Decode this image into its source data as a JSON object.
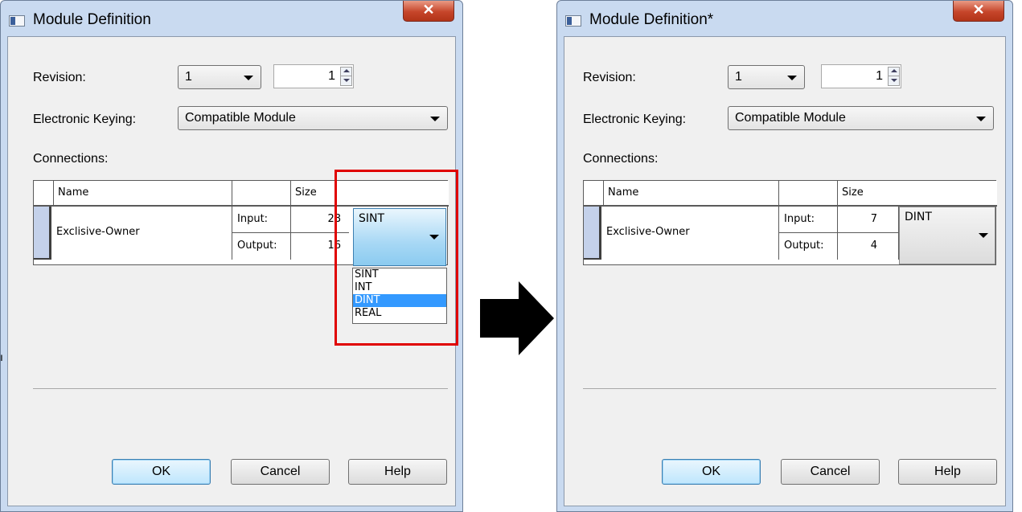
{
  "left": {
    "title": "Module Definition",
    "revision_label": "Revision:",
    "revision_major": "1",
    "revision_minor": "1",
    "keying_label": "Electronic Keying:",
    "keying_value": "Compatible Module",
    "connections_label": "Connections:",
    "grid": {
      "col_name": "Name",
      "col_size": "Size",
      "row_name": "Exclisive-Owner",
      "input_label": "Input:",
      "input_size": "28",
      "output_label": "Output:",
      "output_size": "16",
      "type_value": "SINT"
    },
    "dropdown_options": [
      "SINT",
      "INT",
      "DINT",
      "REAL"
    ],
    "ok_label": "OK",
    "cancel_label": "Cancel",
    "help_label": "Help"
  },
  "right": {
    "title": "Module Definition*",
    "revision_label": "Revision:",
    "revision_major": "1",
    "revision_minor": "1",
    "keying_label": "Electronic Keying:",
    "keying_value": "Compatible Module",
    "connections_label": "Connections:",
    "grid": {
      "col_name": "Name",
      "col_size": "Size",
      "row_name": "Exclisive-Owner",
      "input_label": "Input:",
      "input_size": "7",
      "output_label": "Output:",
      "output_size": "4",
      "type_value": "DINT"
    },
    "ok_label": "OK",
    "cancel_label": "Cancel",
    "help_label": "Help"
  },
  "colors": {
    "highlight_box": "#e00000",
    "selected_option": "#3399ff",
    "window_frame": "#c9daf0"
  },
  "icons": [
    "window-icon",
    "close-icon",
    "dropdown-arrow-icon",
    "spin-up-icon",
    "spin-down-icon",
    "right-arrow-icon"
  ]
}
